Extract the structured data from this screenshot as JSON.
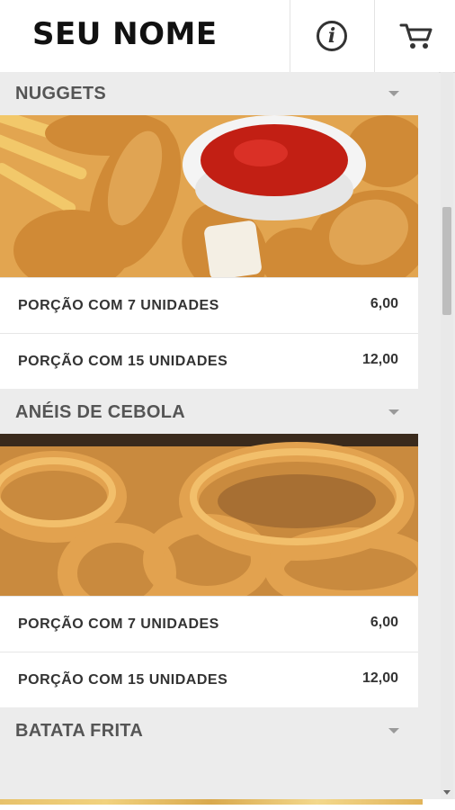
{
  "header": {
    "brand": "SEU NOME",
    "info_icon": "info-icon",
    "cart_icon": "cart-icon"
  },
  "sections": [
    {
      "title": "NUGGETS",
      "image": "nuggets-photo",
      "items": [
        {
          "label": "PORÇÃO COM 7 UNIDADES",
          "price": "6,00"
        },
        {
          "label": "PORÇÃO COM 15 UNIDADES",
          "price": "12,00"
        }
      ]
    },
    {
      "title": "ANÉIS DE CEBOLA",
      "image": "onion-rings-photo",
      "items": [
        {
          "label": "PORÇÃO COM 7 UNIDADES",
          "price": "6,00"
        },
        {
          "label": "PORÇÃO COM 15 UNIDADES",
          "price": "12,00"
        }
      ]
    },
    {
      "title": "BATATA FRITA",
      "image": "fries-photo",
      "items": []
    }
  ]
}
